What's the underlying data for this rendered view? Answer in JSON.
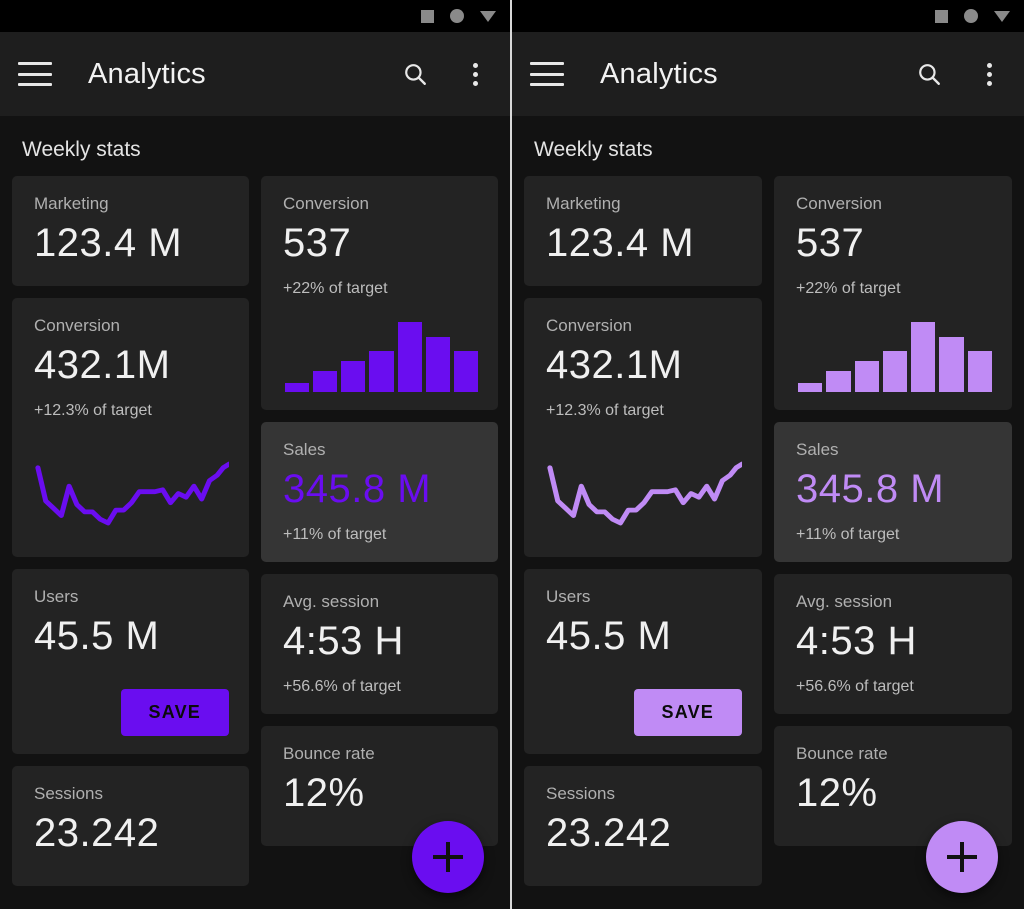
{
  "panels": [
    {
      "id": "left",
      "accent": "#6A0DF0",
      "statusbar": {
        "icons": [
          "square-icon",
          "circle-icon",
          "triangle-down-icon"
        ]
      },
      "appbar": {
        "menu_icon": "hamburger-menu-icon",
        "title": "Analytics",
        "search_icon": "search-icon",
        "overflow_icon": "more-vertical-icon"
      },
      "section_title": "Weekly stats",
      "fab": {
        "icon": "plus-icon",
        "label": "+"
      },
      "save_label": "SAVE",
      "cards": {
        "marketing": {
          "label": "Marketing",
          "value": "123.4 M"
        },
        "conversion_left": {
          "label": "Conversion",
          "value": "432.1M",
          "sub": "+12.3% of target"
        },
        "users": {
          "label": "Users",
          "value": "45.5 M"
        },
        "sessions": {
          "label": "Sessions",
          "value": "23.242"
        },
        "conversion_right": {
          "label": "Conversion",
          "value": "537",
          "sub": "+22% of target"
        },
        "sales": {
          "label": "Sales",
          "value": "345.8 M",
          "sub": "+11% of target"
        },
        "avg_session": {
          "label": "Avg. session",
          "value": "4:53 H",
          "sub": "+56.6% of target"
        },
        "bounce": {
          "label": "Bounce rate",
          "value": "12%"
        }
      }
    },
    {
      "id": "right",
      "accent": "#C08BF5",
      "statusbar": {
        "icons": [
          "square-icon",
          "circle-icon",
          "triangle-down-icon"
        ]
      },
      "appbar": {
        "menu_icon": "hamburger-menu-icon",
        "title": "Analytics",
        "search_icon": "search-icon",
        "overflow_icon": "more-vertical-icon"
      },
      "section_title": "Weekly stats",
      "fab": {
        "icon": "plus-icon",
        "label": "+"
      },
      "save_label": "SAVE",
      "cards": {
        "marketing": {
          "label": "Marketing",
          "value": "123.4 M"
        },
        "conversion_left": {
          "label": "Conversion",
          "value": "432.1M",
          "sub": "+12.3% of target"
        },
        "users": {
          "label": "Users",
          "value": "45.5 M"
        },
        "sessions": {
          "label": "Sessions",
          "value": "23.242"
        },
        "conversion_right": {
          "label": "Conversion",
          "value": "537",
          "sub": "+22% of target"
        },
        "sales": {
          "label": "Sales",
          "value": "345.8 M",
          "sub": "+11% of target"
        },
        "avg_session": {
          "label": "Avg. session",
          "value": "4:53 H",
          "sub": "+56.6% of target"
        },
        "bounce": {
          "label": "Bounce rate",
          "value": "12%"
        }
      }
    }
  ],
  "chart_data": [
    {
      "type": "bar",
      "title": "Conversion weekly bars",
      "categories": [
        "1",
        "2",
        "3",
        "4",
        "5",
        "6",
        "7"
      ],
      "values": [
        10,
        23,
        34,
        45,
        76,
        60,
        44
      ],
      "xlabel": "",
      "ylabel": "",
      "ylim": [
        0,
        80
      ],
      "grid": false,
      "legend": "none",
      "color": "#6A0DF0"
    },
    {
      "type": "line",
      "title": "Conversion trend sparkline",
      "x": [
        0,
        4,
        8,
        12,
        16,
        20,
        24,
        28,
        32,
        36,
        40,
        44,
        48,
        52,
        56,
        60,
        64,
        68,
        72,
        76,
        80,
        84,
        88,
        92,
        96,
        100
      ],
      "values": [
        72,
        36,
        28,
        20,
        52,
        34,
        24,
        24,
        16,
        12,
        26,
        26,
        34,
        46,
        46,
        46,
        48,
        34,
        44,
        40,
        52,
        38,
        58,
        64,
        72,
        76
      ],
      "xlabel": "",
      "ylabel": "",
      "ylim": [
        0,
        100
      ],
      "grid": false,
      "legend": "none",
      "color": "#6A0DF0"
    }
  ]
}
